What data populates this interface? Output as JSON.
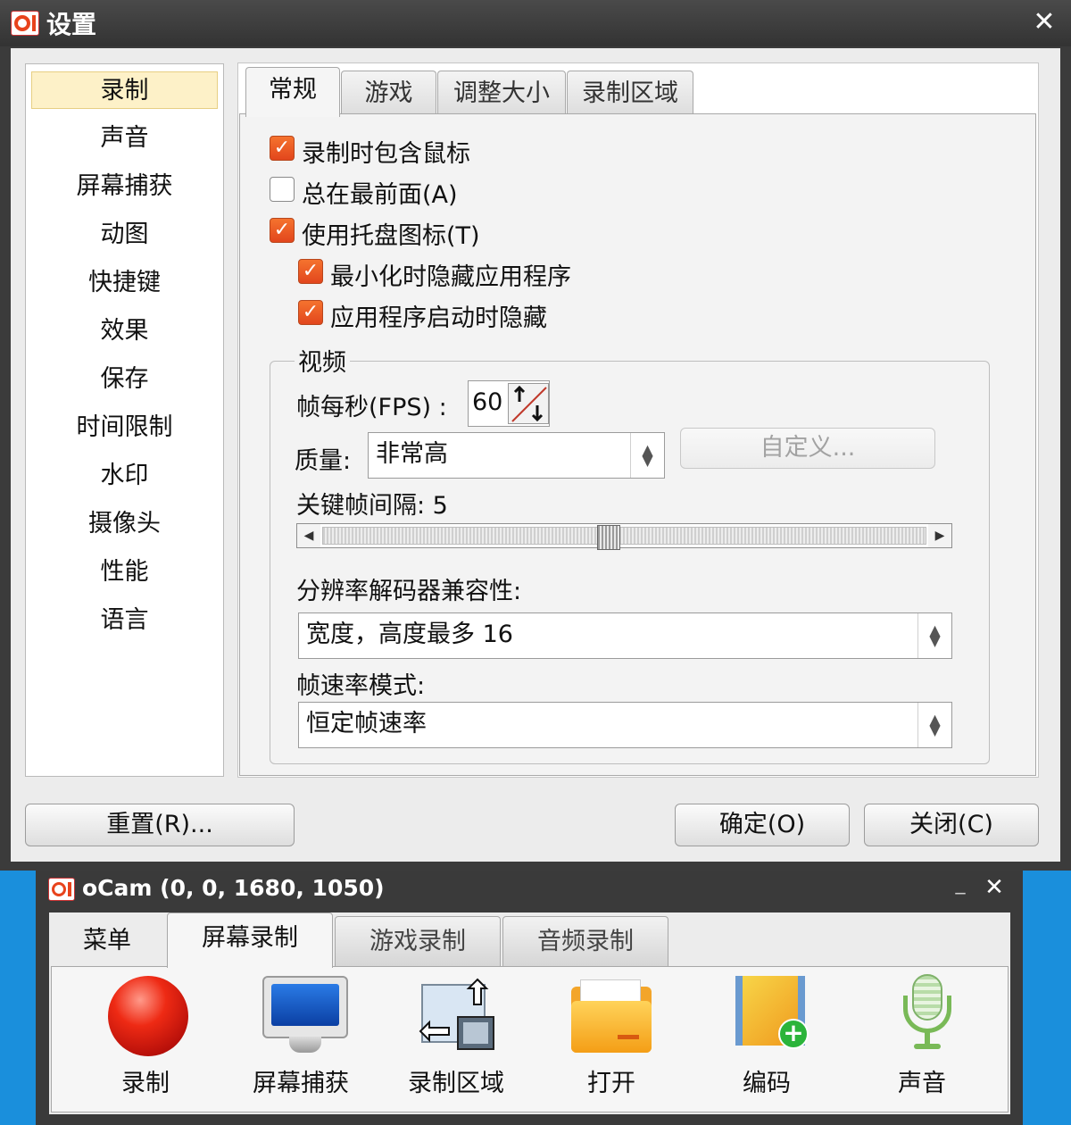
{
  "settings_window": {
    "title": "设置",
    "close_glyph": "✕",
    "nav": {
      "selected": 0,
      "items": [
        "录制",
        "声音",
        "屏幕捕获",
        "动图",
        "快捷键",
        "效果",
        "保存",
        "时间限制",
        "水印",
        "摄像头",
        "性能",
        "语言"
      ]
    },
    "tabs": [
      "常规",
      "游戏",
      "调整大小",
      "录制区域"
    ],
    "active_tab": 0,
    "options": [
      {
        "label": "录制时包含鼠标",
        "checked": true
      },
      {
        "label": "总在最前面(A)",
        "checked": false
      },
      {
        "label": "使用托盘图标(T)",
        "checked": true
      },
      {
        "label": "最小化时隐藏应用程序",
        "checked": true
      },
      {
        "label": "应用程序启动时隐藏",
        "checked": true
      }
    ],
    "check_glyph": "✓",
    "video": {
      "legend": "视频",
      "fps_label": "帧每秒(FPS) :",
      "fps_value": "60",
      "quality_label": "质量:",
      "quality_value": "非常高",
      "custom_button": "自定义...",
      "keyframe_label": "关键帧间隔: 5",
      "keyframe_value": 5,
      "resolution_label": "分辨率解码器兼容性:",
      "resolution_value": "宽度，高度最多 16",
      "framerate_label": "帧速率模式:",
      "framerate_value": "恒定帧速率"
    },
    "buttons": {
      "reset": "重置(R)...",
      "ok": "确定(O)",
      "close": "关闭(C)"
    }
  },
  "ocam_window": {
    "title": "oCam (0, 0, 1680, 1050)",
    "minimize_glyph": "_",
    "close_glyph": "✕",
    "tabs": [
      "菜单",
      "屏幕录制",
      "游戏录制",
      "音频录制"
    ],
    "active_tab": 1,
    "tools": [
      {
        "label": "录制",
        "icon": "record-icon"
      },
      {
        "label": "屏幕捕获",
        "icon": "monitor-icon"
      },
      {
        "label": "录制区域",
        "icon": "capture-area-icon"
      },
      {
        "label": "打开",
        "icon": "folder-icon"
      },
      {
        "label": "编码",
        "icon": "film-encode-icon"
      },
      {
        "label": "声音",
        "icon": "microphone-icon"
      }
    ]
  },
  "colors": {
    "accent_orange": "#e8431c",
    "desktop_blue": "#1a8fdc",
    "title_bar": "#3b3b3b"
  }
}
